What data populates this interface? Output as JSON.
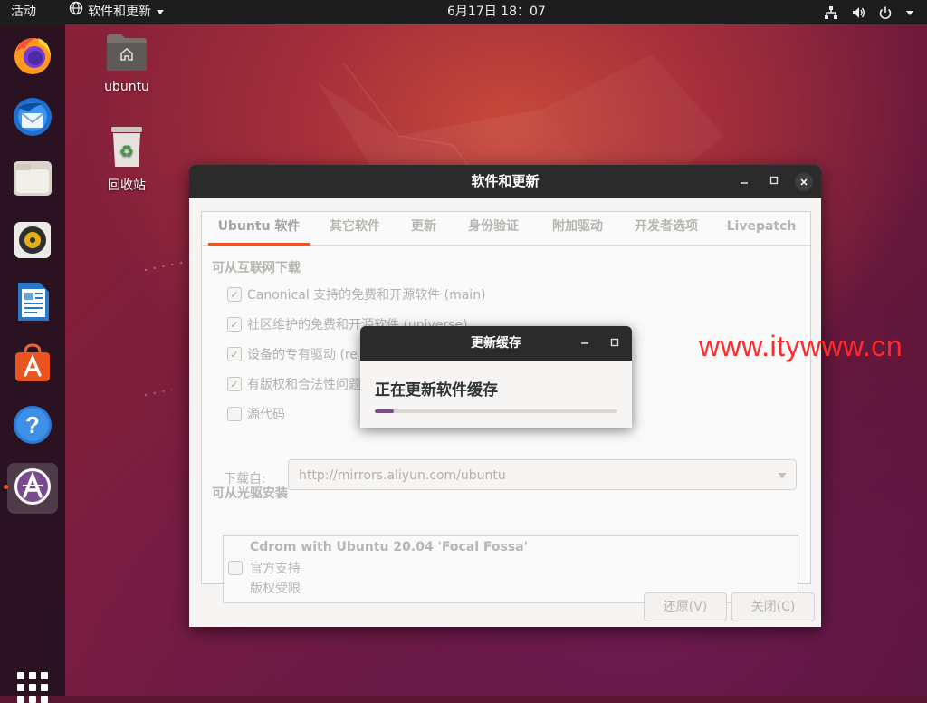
{
  "topbar": {
    "activities": "活动",
    "app_menu": "软件和更新",
    "clock": "6月17日  18：07",
    "tray_icons": [
      "network-icon",
      "volume-icon",
      "power-icon",
      "chevron-down-icon"
    ]
  },
  "dock": {
    "items": [
      "firefox",
      "thunderbird",
      "files",
      "rhythmbox",
      "libreoffice-writer",
      "ubuntu-software",
      "help",
      "software-updates"
    ],
    "show_apps": "show-applications"
  },
  "desktop": {
    "home_label": "ubuntu",
    "trash_label": "回收站"
  },
  "window": {
    "title": "软件和更新",
    "tabs": [
      "Ubuntu 软件",
      "其它软件",
      "更新",
      "身份验证",
      "附加驱动",
      "开发者选项",
      "Livepatch"
    ],
    "active_tab": "Ubuntu 软件",
    "internet_section": "可从互联网下载",
    "sources": [
      {
        "label": "Canonical 支持的免费和开源软件 (main)",
        "checked": true
      },
      {
        "label": "社区维护的免费和开源软件 (universe)",
        "checked": true
      },
      {
        "label": "设备的专有驱动 (re",
        "checked": true
      },
      {
        "label": "有版权和合法性问题",
        "checked": true
      },
      {
        "label": "源代码",
        "checked": false
      }
    ],
    "download_from_label": "下载自:",
    "download_from_value": "http://mirrors.aliyun.com/ubuntu",
    "cdrom_section": "可从光驱安装",
    "cdrom": {
      "name": "Cdrom with Ubuntu 20.04 'Focal Fossa'",
      "line2": "官方支持",
      "line3": "版权受限",
      "checked": false
    },
    "revert_button": "还原(V)",
    "close_button": "关闭(C)"
  },
  "dialog": {
    "title": "更新缓存",
    "message": "正在更新软件缓存",
    "progress": 0.08
  },
  "watermark": "www.itywww.cn",
  "colors": {
    "accent": "#e95420",
    "progress": "#7e4a8c",
    "titlebar": "#2b2b2b",
    "watermark": "#ff2a2a"
  }
}
